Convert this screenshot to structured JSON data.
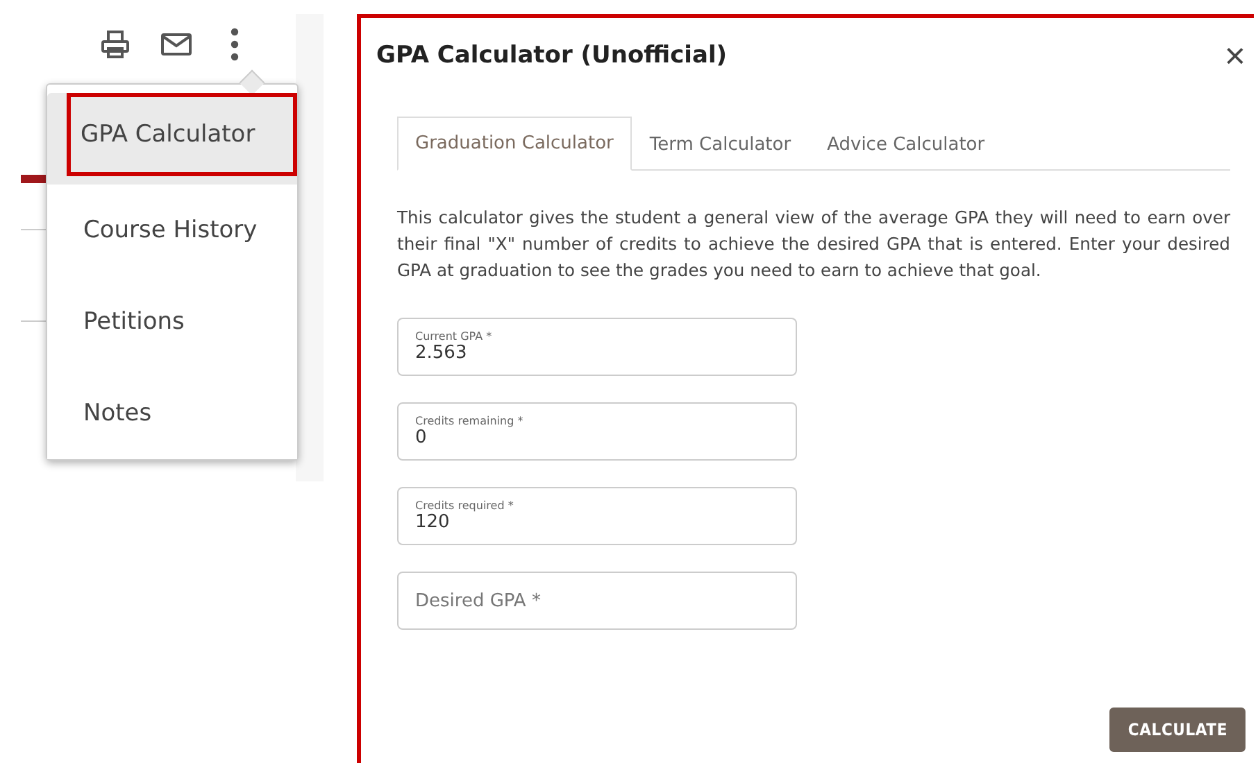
{
  "menu": {
    "items": [
      {
        "label": "GPA Calculator",
        "selected": true
      },
      {
        "label": "Course History",
        "selected": false
      },
      {
        "label": "Petitions",
        "selected": false
      },
      {
        "label": "Notes",
        "selected": false
      }
    ]
  },
  "dialog": {
    "title": "GPA Calculator (Unofficial)",
    "close": "×",
    "tabs": [
      {
        "label": "Graduation Calculator",
        "selected": true
      },
      {
        "label": "Term Calculator",
        "selected": false
      },
      {
        "label": "Advice Calculator",
        "selected": false
      }
    ],
    "description": "This calculator gives the student a general view of the average GPA they will need to earn over their final \"X\" number of credits to achieve the desired GPA that is entered. Enter your desired GPA at graduation to see the grades you need to earn to achieve that goal.",
    "fields": [
      {
        "kind": "filled",
        "label": "Current GPA *",
        "value": "2.563"
      },
      {
        "kind": "filled",
        "label": "Credits remaining *",
        "value": "0"
      },
      {
        "kind": "filled",
        "label": "Credits required *",
        "value": "120"
      },
      {
        "kind": "empty",
        "placeholder": "Desired GPA *"
      }
    ],
    "button": "CALCULATE"
  }
}
